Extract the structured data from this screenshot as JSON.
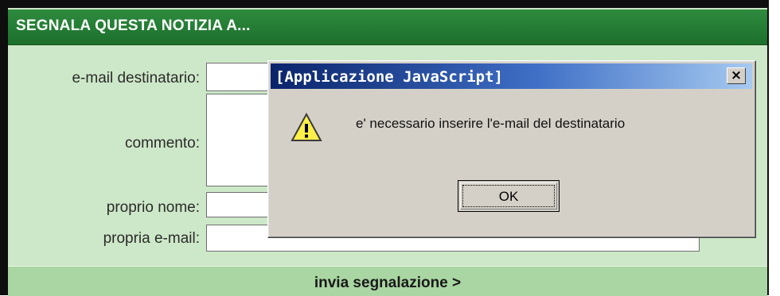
{
  "form": {
    "header_title": "SEGNALA QUESTA NOTIZIA A...",
    "labels": {
      "recipient_email": "e-mail destinatario:",
      "comment": "commento:",
      "own_name": "proprio nome:",
      "own_email": "propria e-mail:"
    },
    "submit_label": "invia segnalazione >"
  },
  "dialog": {
    "title": "[Applicazione JavaScript]",
    "close_label": "×",
    "message": "e' necessario inserire l'e-mail del destinatario",
    "ok_label": "OK",
    "icon": "warning-icon"
  },
  "colors": {
    "header_green": "#1c6f2c",
    "panel_green": "#cde8c8",
    "footer_green": "#a9d6a2",
    "dialog_gray": "#d4d0c8",
    "titlebar_blue": "#0a246a"
  }
}
